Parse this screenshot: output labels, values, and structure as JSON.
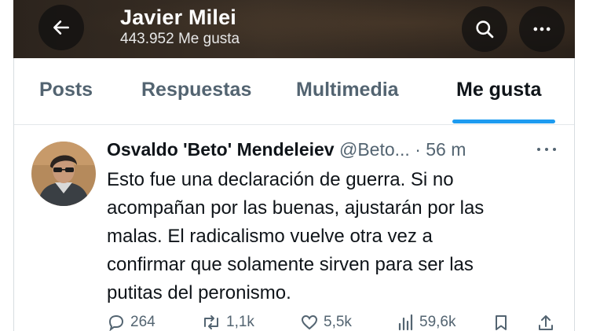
{
  "header": {
    "title": "Javier Milei",
    "subtitle": "443.952 Me gusta"
  },
  "tabs": [
    {
      "label": "Posts"
    },
    {
      "label": "Respuestas"
    },
    {
      "label": "Multimedia"
    },
    {
      "label": "Me gusta",
      "active": true
    }
  ],
  "tweet": {
    "author": "Osvaldo 'Beto' Mendeleiev",
    "handle": "@Beto...",
    "separator": "·",
    "time": "56 m",
    "text_lines": [
      "Esto fue una declaración de guerra. Si no",
      "acompañan por las buenas, ajustarán por las",
      "malas. El radicalismo vuelve otra vez a",
      "confirmar que solamente sirven para ser las",
      "putitas del peronismo."
    ],
    "stats": {
      "replies": "264",
      "reposts": "1,1k",
      "likes": "5,5k",
      "views": "59,6k"
    }
  },
  "icons": {
    "back": "back-arrow-icon",
    "search": "search-icon",
    "more": "more-icon",
    "reply": "reply-icon",
    "repost": "repost-icon",
    "like": "heart-icon",
    "views": "views-icon",
    "bookmark": "bookmark-icon",
    "share": "share-icon"
  },
  "colors": {
    "accent": "#1d9bf0",
    "text": "#0f1419",
    "muted": "#536471",
    "header_bg": "#2c241d"
  }
}
